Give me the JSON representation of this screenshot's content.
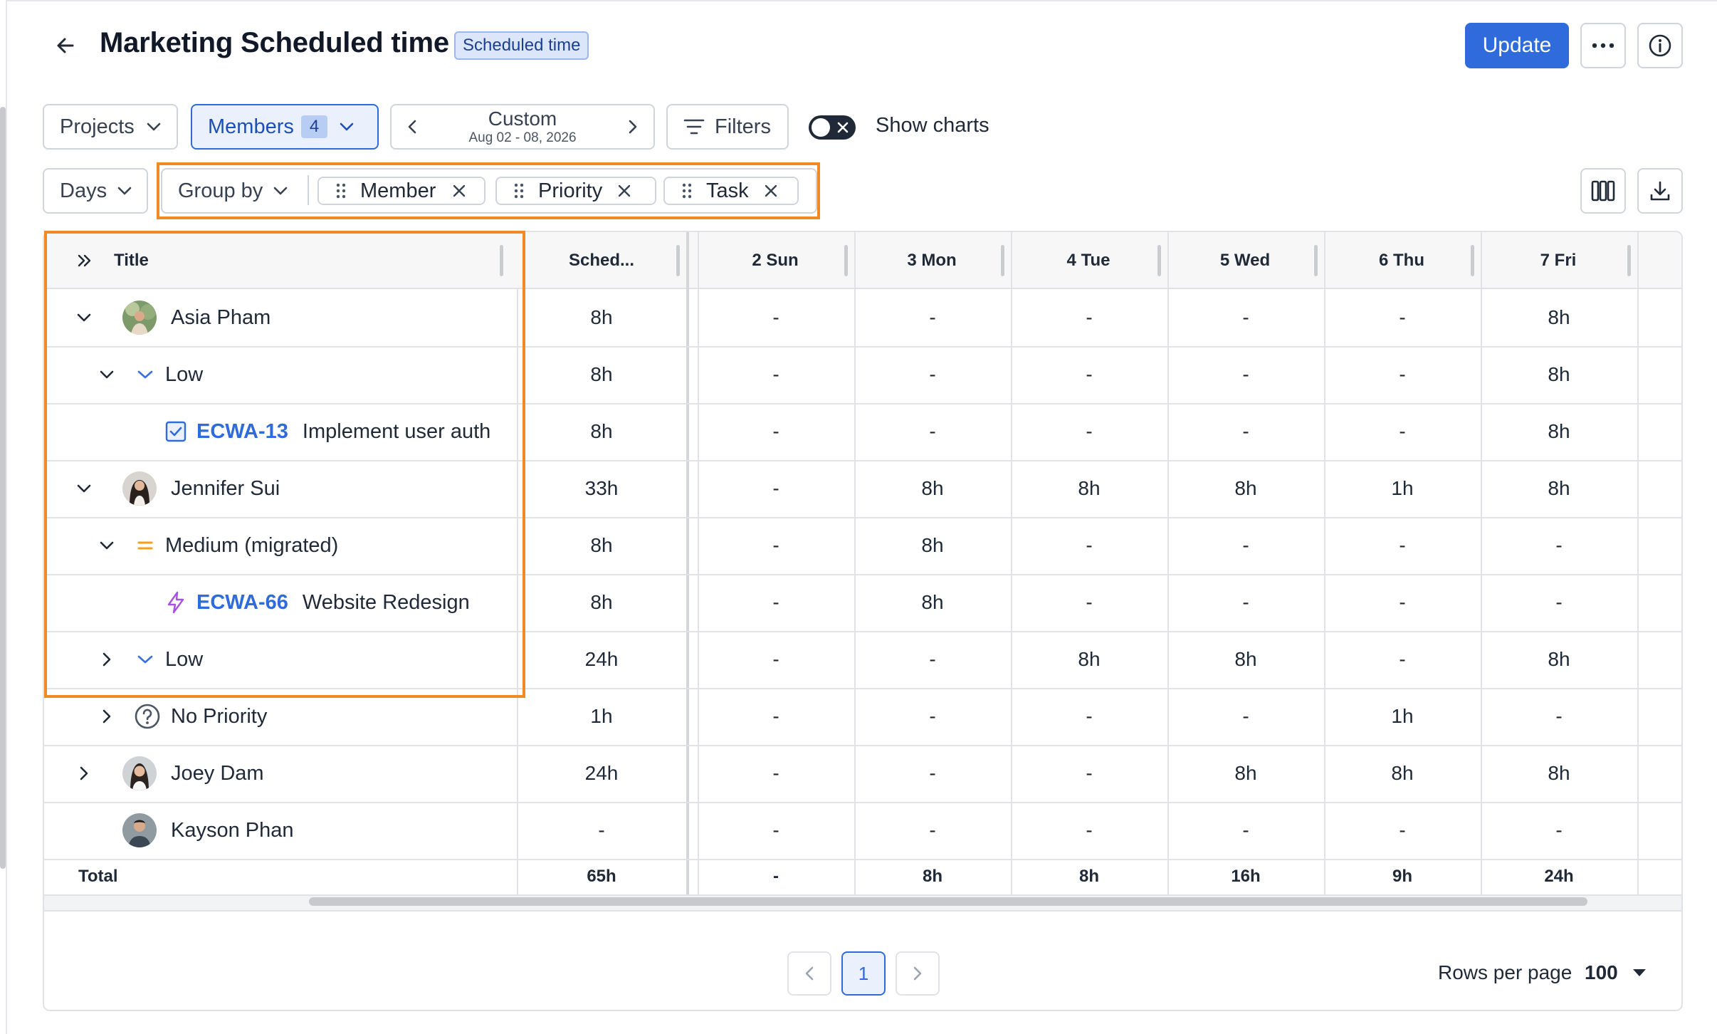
{
  "header": {
    "title": "Marketing Scheduled time",
    "badge": "Scheduled time",
    "update_label": "Update"
  },
  "toolbar": {
    "projects_label": "Projects",
    "members_label": "Members",
    "members_count": "4",
    "date_range_label": "Custom",
    "date_range_sub": "Aug 02 - 08, 2026",
    "filters_label": "Filters",
    "show_charts_label": "Show charts",
    "show_charts_on": false
  },
  "grouping": {
    "granularity_label": "Days",
    "group_by_label": "Group by",
    "chips": [
      "Member",
      "Priority",
      "Task"
    ]
  },
  "table": {
    "columns": [
      "Title",
      "Sched...",
      "2 Sun",
      "3 Mon",
      "4 Tue",
      "5 Wed",
      "6 Thu",
      "7 Fri"
    ],
    "rows": [
      {
        "title": "Asia Pham",
        "values": [
          "8h",
          "-",
          "-",
          "-",
          "-",
          "-",
          "8h"
        ]
      },
      {
        "title": "Low",
        "values": [
          "8h",
          "-",
          "-",
          "-",
          "-",
          "-",
          "8h"
        ]
      },
      {
        "ticket": "ECWA-13",
        "title": "Implement user auth",
        "values": [
          "8h",
          "-",
          "-",
          "-",
          "-",
          "-",
          "8h"
        ]
      },
      {
        "title": "Jennifer Sui",
        "values": [
          "33h",
          "-",
          "8h",
          "8h",
          "8h",
          "1h",
          "8h"
        ]
      },
      {
        "title": "Medium (migrated)",
        "values": [
          "8h",
          "-",
          "8h",
          "-",
          "-",
          "-",
          "-"
        ]
      },
      {
        "ticket": "ECWA-66",
        "title": "Website Redesign",
        "values": [
          "8h",
          "-",
          "8h",
          "-",
          "-",
          "-",
          "-"
        ]
      },
      {
        "title": "Low",
        "values": [
          "24h",
          "-",
          "-",
          "8h",
          "8h",
          "-",
          "8h"
        ]
      },
      {
        "title": "No Priority",
        "values": [
          "1h",
          "-",
          "-",
          "-",
          "-",
          "1h",
          "-"
        ]
      },
      {
        "title": "Joey Dam",
        "values": [
          "24h",
          "-",
          "-",
          "-",
          "8h",
          "8h",
          "8h"
        ]
      },
      {
        "title": "Kayson Phan",
        "values": [
          "-",
          "-",
          "-",
          "-",
          "-",
          "-",
          "-"
        ]
      }
    ],
    "total": {
      "title": "Total",
      "values": [
        "65h",
        "-",
        "8h",
        "8h",
        "16h",
        "9h",
        "24h"
      ]
    }
  },
  "pagination": {
    "current_page": "1",
    "rows_per_page_label": "Rows per page",
    "rows_per_page_value": "100"
  },
  "colors": {
    "accent": "#2f6bdb",
    "highlight": "#f08a24",
    "low_priority": "#3b6fe0",
    "medium_priority": "#f2a31b",
    "story_icon": "#a452e8"
  }
}
